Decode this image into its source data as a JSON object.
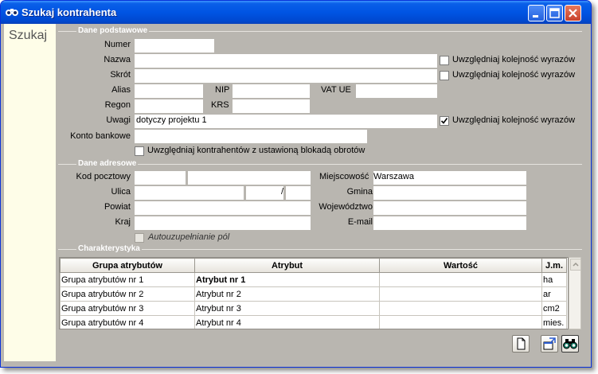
{
  "window": {
    "title": "Szukaj kontrahenta"
  },
  "sidebar": {
    "title": "Szukaj"
  },
  "sections": {
    "basic": "Dane podstawowe",
    "address": "Dane adresowe",
    "attributes": "Charakterystyka"
  },
  "basic": {
    "numer_label": "Numer",
    "numer_value": "",
    "nazwa_label": "Nazwa",
    "nazwa_value": "",
    "skrot_label": "Skrót",
    "skrot_value": "",
    "alias_label": "Alias",
    "alias_value": "",
    "nip_label": "NIP",
    "nip_value": "",
    "vatue_label": "VAT UE",
    "vatue_value": "",
    "regon_label": "Regon",
    "regon_value": "",
    "krs_label": "KRS",
    "krs_value": "",
    "uwagi_label": "Uwagi",
    "uwagi_value": "dotyczy projektu 1",
    "konto_label": "Konto bankowe",
    "konto_value": "",
    "order_label_nazwa": "Uwzględniaj kolejność wyrazów",
    "order_label_skrot": "Uwzględniaj kolejność wyrazów",
    "order_label_uwagi": "Uwzględniaj kolejność wyrazów",
    "order_nazwa_checked": false,
    "order_skrot_checked": false,
    "order_uwagi_checked": true,
    "blocked_label": "Uwzględniaj kontrahentów z ustawioną blokadą obrotów",
    "blocked_checked": false
  },
  "address": {
    "kod_label": "Kod pocztowy",
    "kod_value": "",
    "kod_value2": "",
    "miejscowosc_label": "Miejscowość",
    "miejscowosc_value": "Warszawa",
    "ulica_label": "Ulica",
    "ulica_value": "",
    "nr_domu": "",
    "separator": "/",
    "nr_lokalu": "",
    "gmina_label": "Gmina",
    "gmina_value": "",
    "powiat_label": "Powiat",
    "powiat_value": "",
    "wojewodztwo_label": "Województwo",
    "wojewodztwo_value": "",
    "kraj_label": "Kraj",
    "kraj_value": "",
    "email_label": "E-mail",
    "email_value": "",
    "autocomplete_label": "Autouzupełnianie pól",
    "autocomplete_checked": false
  },
  "grid": {
    "columns": [
      "Grupa atrybutów",
      "Atrybut",
      "Wartość",
      "J.m."
    ],
    "rows": [
      [
        "Grupa atrybutów nr 1",
        "Atrybut nr 1",
        "",
        "ha"
      ],
      [
        "Grupa atrybutów nr 2",
        "Atrybut nr 2",
        "",
        "ar"
      ],
      [
        "Grupa atrybutów nr 3",
        "Atrybut nr 3",
        "",
        "cm2"
      ],
      [
        "Grupa atrybutów nr 4",
        "Atrybut nr 4",
        "",
        "mies."
      ]
    ]
  },
  "icons": {
    "window": "binoculars-icon",
    "minimize": "minimize-icon",
    "maximize": "maximize-icon",
    "close": "close-icon",
    "new_document": "new-document-icon",
    "export": "export-icon",
    "search": "binoculars-icon"
  },
  "colors": {
    "titlebar": "#0054e3",
    "sidebar": "#fefde8",
    "panel": "#b9b6b0",
    "section_text": "#ffffff"
  }
}
